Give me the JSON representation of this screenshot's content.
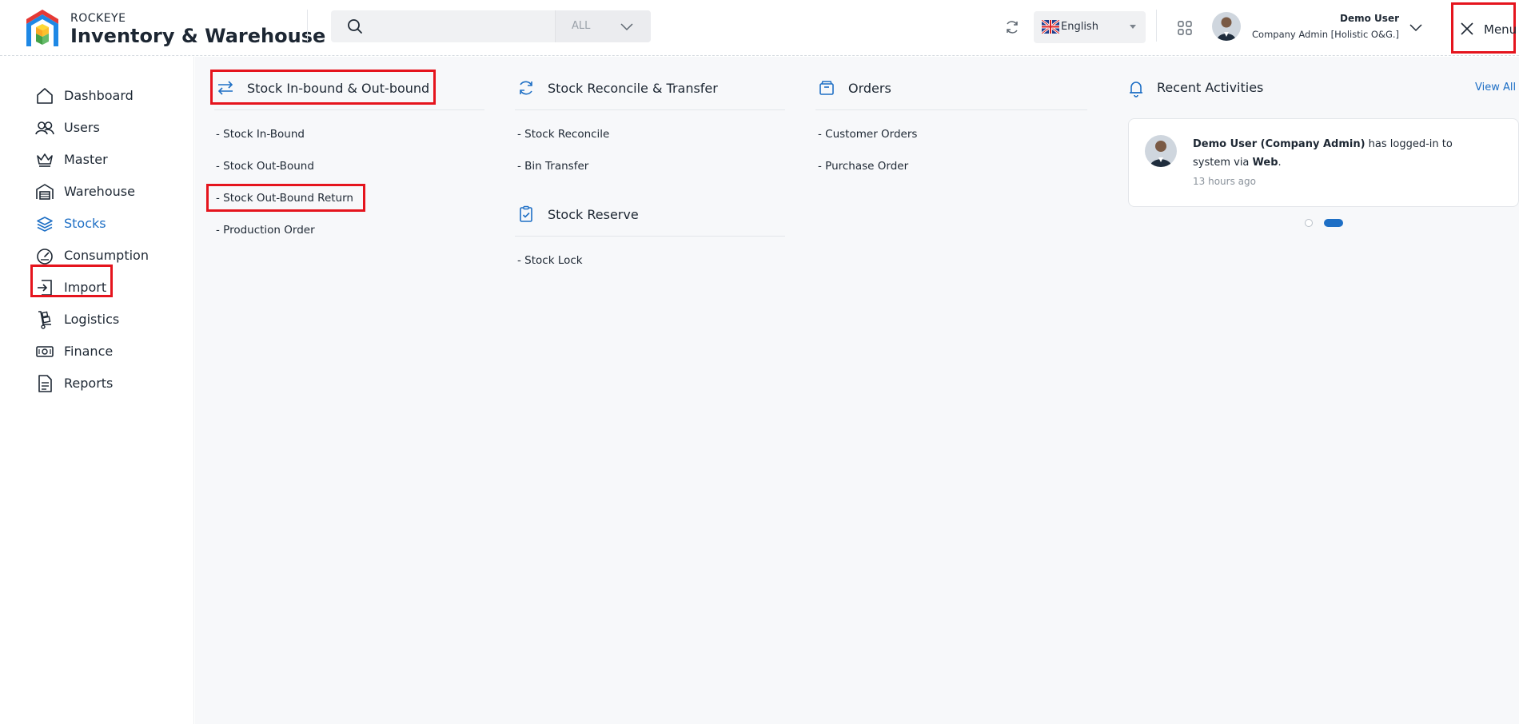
{
  "header": {
    "brand_top": "ROCKEYE",
    "brand_main": "Inventory & Warehouse",
    "search": {
      "placeholder": "",
      "filter_label": "ALL"
    },
    "language": "English",
    "user": {
      "name": "Demo User",
      "role": "Company Admin [Holistic O&G.]"
    },
    "menu_label": "Menu"
  },
  "sidebar": {
    "items": [
      {
        "label": "Dashboard",
        "icon": "home-icon"
      },
      {
        "label": "Users",
        "icon": "users-icon"
      },
      {
        "label": "Master",
        "icon": "crown-icon"
      },
      {
        "label": "Warehouse",
        "icon": "warehouse-icon"
      },
      {
        "label": "Stocks",
        "icon": "layers-icon",
        "active": true
      },
      {
        "label": "Consumption",
        "icon": "gauge-icon"
      },
      {
        "label": "Import",
        "icon": "import-icon"
      },
      {
        "label": "Logistics",
        "icon": "hand-truck-icon"
      },
      {
        "label": "Finance",
        "icon": "money-icon"
      },
      {
        "label": "Reports",
        "icon": "report-icon"
      }
    ]
  },
  "menu": {
    "inout": {
      "title": "Stock In-bound & Out-bound",
      "links": [
        "- Stock In-Bound",
        "- Stock Out-Bound",
        "- Stock Out-Bound Return",
        "- Production Order"
      ]
    },
    "reconcile": {
      "title": "Stock Reconcile & Transfer",
      "links": [
        "- Stock Reconcile",
        "- Bin Transfer"
      ]
    },
    "reserve": {
      "title": "Stock Reserve",
      "links": [
        "- Stock Lock"
      ]
    },
    "orders": {
      "title": "Orders",
      "links": [
        "- Customer Orders",
        "- Purchase Order"
      ]
    }
  },
  "activities": {
    "title": "Recent Activities",
    "view_all": "View All",
    "items": [
      {
        "actor": "Demo User (Company Admin)",
        "action": " has logged-in to system via ",
        "via": "Web",
        "end": ".",
        "time": "13 hours ago"
      }
    ],
    "pager": {
      "count": 2,
      "active": 2
    }
  },
  "colors": {
    "accent": "#1e6fc5",
    "highlight": "#e5141d"
  }
}
